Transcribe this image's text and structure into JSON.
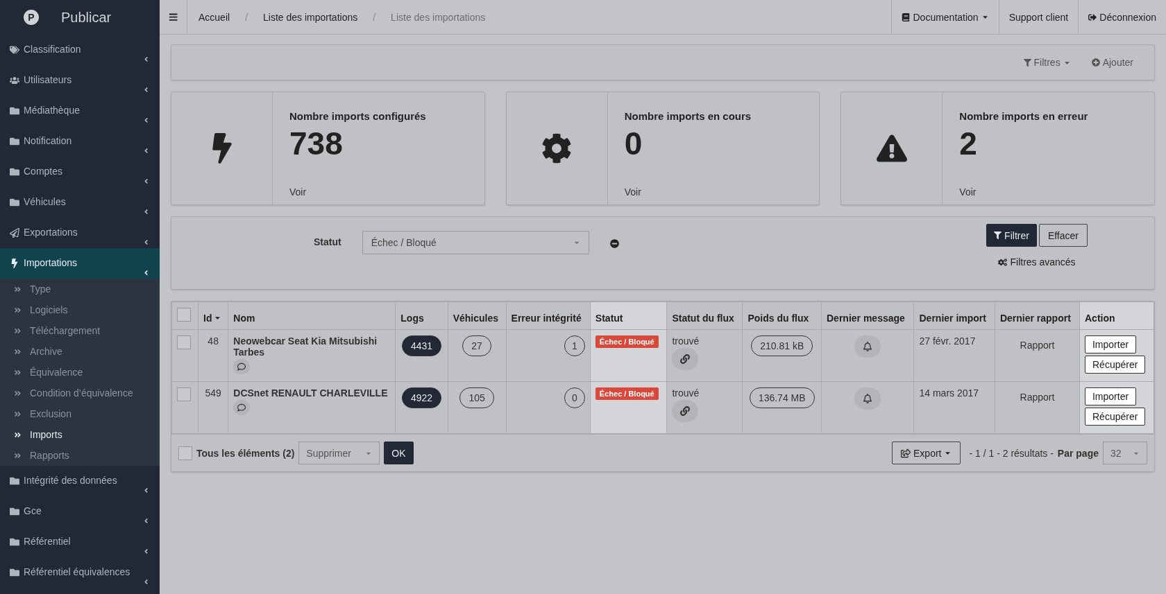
{
  "brand": {
    "logo_mark": "P",
    "name": "Publicar"
  },
  "sidebar": {
    "items": [
      {
        "label": "Classification",
        "expanded": false
      },
      {
        "label": "Utilisateurs",
        "expanded": false
      },
      {
        "label": "Médiathèque",
        "expanded": false
      },
      {
        "label": "Notification",
        "expanded": false
      },
      {
        "label": "Comptes",
        "expanded": false
      },
      {
        "label": "Véhicules",
        "expanded": false
      },
      {
        "label": "Exportations",
        "expanded": false
      },
      {
        "label": "Importations",
        "expanded": true,
        "children": [
          {
            "label": "Type",
            "selected": false
          },
          {
            "label": "Logiciels",
            "selected": false
          },
          {
            "label": "Téléchargement",
            "selected": false
          },
          {
            "label": "Archive",
            "selected": false
          },
          {
            "label": "Équivalence",
            "selected": false
          },
          {
            "label": "Condition d’équivalence",
            "selected": false
          },
          {
            "label": "Exclusion",
            "selected": false
          },
          {
            "label": "Imports",
            "selected": true
          },
          {
            "label": "Rapports",
            "selected": false
          }
        ]
      },
      {
        "label": "Intégrité des données",
        "expanded": false
      },
      {
        "label": "Gce",
        "expanded": false
      },
      {
        "label": "Référentiel",
        "expanded": false
      },
      {
        "label": "Référentiel équivalences",
        "expanded": false
      }
    ]
  },
  "breadcrumb": [
    {
      "label": "Accueil",
      "current": false
    },
    {
      "label": "Liste des importations",
      "current": false
    },
    {
      "label": "Liste des importations",
      "current": true
    }
  ],
  "breadcrumb_separator": "/",
  "top_links": [
    {
      "label": "Documentation",
      "dropdown": true
    },
    {
      "label": "Support client",
      "dropdown": false
    },
    {
      "label": "Déconnexion",
      "dropdown": false
    }
  ],
  "toolbar": {
    "filters": "Filtres",
    "add": "Ajouter"
  },
  "stats": [
    {
      "title": "Nombre imports configurés",
      "value": "738",
      "link": "Voir"
    },
    {
      "title": "Nombre imports en cours",
      "value": "0",
      "link": "Voir"
    },
    {
      "title": "Nombre imports en erreur",
      "value": "2",
      "link": "Voir"
    }
  ],
  "filter": {
    "label": "Statut",
    "value": "Échec / Bloqué",
    "apply": "Filtrer",
    "clear": "Effacer",
    "advanced": "Filtres avancés"
  },
  "table": {
    "header_checked": false,
    "columns": [
      {
        "label": "Id",
        "sorted": true,
        "spotlight": false
      },
      {
        "label": "Nom",
        "sorted": false,
        "spotlight": false
      },
      {
        "label": "Logs",
        "sorted": false,
        "spotlight": false
      },
      {
        "label": "Véhicules",
        "sorted": false,
        "spotlight": false
      },
      {
        "label": "Erreur intégrité",
        "sorted": false,
        "spotlight": false
      },
      {
        "label": "Statut",
        "sorted": false,
        "spotlight": true
      },
      {
        "label": "Statut du flux",
        "sorted": false,
        "spotlight": false
      },
      {
        "label": "Poids du flux",
        "sorted": false,
        "spotlight": false
      },
      {
        "label": "Dernier message",
        "sorted": false,
        "spotlight": false
      },
      {
        "label": "Dernier import",
        "sorted": false,
        "spotlight": false
      },
      {
        "label": "Dernier rapport",
        "sorted": false,
        "spotlight": false
      },
      {
        "label": "Action",
        "sorted": false,
        "spotlight": true
      }
    ],
    "rows": [
      {
        "checked": false,
        "id": "48",
        "name": "Neowebcar Seat Kia Mitsubishi Tarbes",
        "logs": "4431",
        "vehicles": "27",
        "errors": "1",
        "status": "Échec / Bloqué",
        "flux_status": "trouvé",
        "flux_size": "210.81 kB",
        "last_import": "27 févr. 2017",
        "report": "Rapport",
        "actions": [
          "Importer",
          "Récupérer"
        ]
      },
      {
        "checked": false,
        "id": "549",
        "name": "DCSnet RENAULT CHARLEVILLE",
        "logs": "4922",
        "vehicles": "105",
        "errors": "0",
        "status": "Échec / Bloqué",
        "flux_status": "trouvé",
        "flux_size": "136.74 MB",
        "last_import": "14 mars 2017",
        "report": "Rapport",
        "actions": [
          "Importer",
          "Récupérer"
        ]
      }
    ]
  },
  "footer": {
    "select_all": "Tous les éléments (2)",
    "select_all_checked": false,
    "bulk_action": "Supprimer",
    "ok": "OK",
    "export": "Export",
    "page_info": "- 1 / 1 - 2 résultats -",
    "per_page_label": "Par page",
    "per_page": "32"
  }
}
